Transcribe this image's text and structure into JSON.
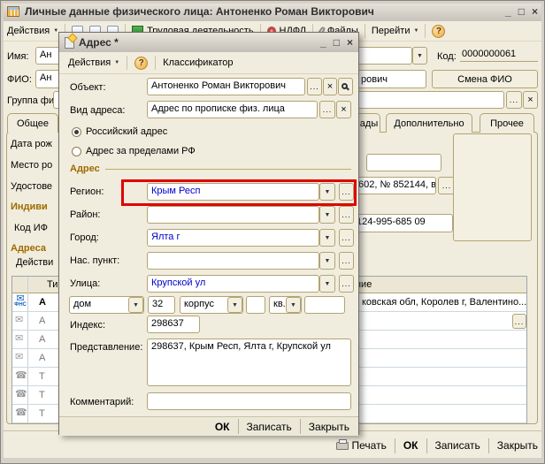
{
  "glyphs": {
    "dropdown": "▼",
    "ellipsis": "...",
    "minimize": "_",
    "maximize": "□",
    "close": "×",
    "help": "?",
    "envelope": "✉",
    "phone": "☎"
  },
  "colors": {
    "highlight_red": "#e00000",
    "value_blue": "#0000c8",
    "section_header_brown": "#9e6a00"
  },
  "main": {
    "title": "Личные данные физического лица: Антоненко Роман Викторович",
    "toolbar": {
      "actions": "Действия",
      "employment": "Трудовая деятельность",
      "ndfl": "НДФЛ",
      "files": "Файлы",
      "goto": "Перейти"
    },
    "form": {
      "name_label": "Имя:",
      "name_value": "Ан",
      "code_label": "Код:",
      "code_value": "0000000061",
      "fio_label": "ФИО:",
      "fio_value_start": "Ан",
      "fio_value_end": "рович",
      "change_fio_button": "Смена ФИО",
      "group_label": "Группа фи",
      "tabs": {
        "general": "Общее",
        "partial": "ады",
        "additional": "Дополнительно",
        "other": "Прочее"
      },
      "left_labels": {
        "birth_date": "Дата рож",
        "birth_place": "Место ро",
        "identity_doc": "Удостове",
        "individual_numbers": "Индиви",
        "ifns_code": "Код ИФ",
        "addresses": "Адреса"
      },
      "identity_doc_fragment": "602, № 852144, в",
      "insurance_number": "124-995-685 09"
    },
    "contacts": {
      "actions_fragment": "Действи",
      "type_header": "Тип",
      "view_header": "Представление",
      "row1_view": "ковская обл, Королев г, Валентино...",
      "fns_badge": "ФНС",
      "row_types": [
        "А",
        "А",
        "А",
        "А",
        "Т",
        "Т",
        "Т"
      ]
    },
    "footer": {
      "print": "Печать",
      "ok": "ОК",
      "save": "Записать",
      "close": "Закрыть"
    }
  },
  "dialog": {
    "title": "Адрес *",
    "toolbar": {
      "actions": "Действия",
      "classifier": "Классификатор"
    },
    "object_label": "Объект:",
    "object_value": "Антоненко Роман Викторович",
    "kind_label": "Вид адреса:",
    "kind_value": "Адрес по прописке физ. лица",
    "radio_russian": "Российский адрес",
    "radio_foreign": "Адрес за пределами РФ",
    "section_address": "Адрес",
    "region_label": "Регион:",
    "region_value": "Крым Респ",
    "district_label": "Район:",
    "district_value": "",
    "city_label": "Город:",
    "city_value": "Ялта г",
    "settlement_label": "Нас. пункт:",
    "settlement_value": "",
    "street_label": "Улица:",
    "street_value": "Крупской ул",
    "house_label": "дом",
    "house_value": "32",
    "building_label": "корпус",
    "building_value": "",
    "flat_label": "кв.",
    "flat_value": "",
    "index_label": "Индекс:",
    "index_value": "298637",
    "view_label": "Представление:",
    "view_value": "298637, Крым Респ, Ялта г, Крупской ул",
    "comment_label": "Комментарий:",
    "comment_value": "",
    "footer": {
      "ok": "ОК",
      "save": "Записать",
      "close": "Закрыть"
    }
  }
}
